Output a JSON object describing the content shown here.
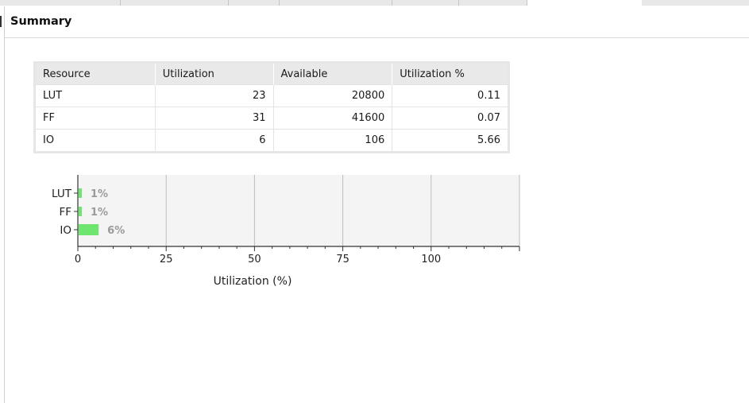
{
  "header": {
    "title": "Summary"
  },
  "table": {
    "columns": [
      "Resource",
      "Utilization",
      "Available",
      "Utilization %"
    ],
    "rows": [
      [
        "LUT",
        "23",
        "20800",
        "0.11"
      ],
      [
        "FF",
        "31",
        "41600",
        "0.07"
      ],
      [
        "IO",
        "6",
        "106",
        "5.66"
      ]
    ]
  },
  "chart_data": {
    "type": "bar",
    "orientation": "horizontal",
    "categories": [
      "LUT",
      "FF",
      "IO"
    ],
    "values": [
      0.11,
      0.07,
      5.66
    ],
    "data_labels": [
      "1%",
      "1%",
      "6%"
    ],
    "xlabel": "Utilization (%)",
    "ylabel": "",
    "title": "",
    "xlim": [
      0,
      125
    ],
    "xticks": [
      "0",
      "25",
      "50",
      "75",
      "100"
    ],
    "grid": true,
    "bar_color": "#6ee56e",
    "label_color": "#9a9a9a",
    "plot_bg": "#f4f4f4"
  }
}
